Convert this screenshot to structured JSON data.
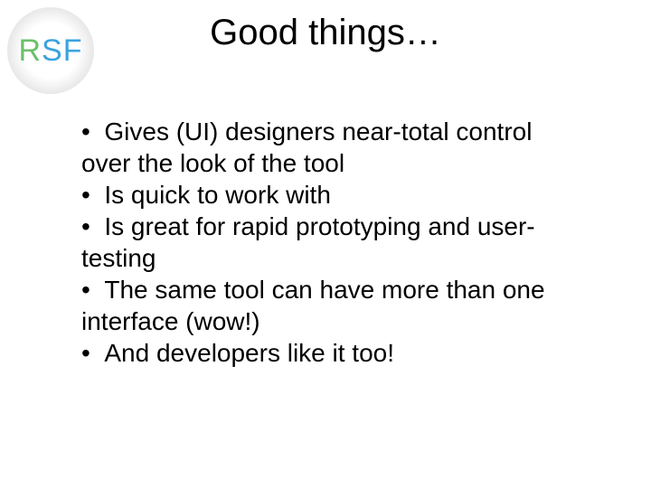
{
  "logo": {
    "letters": {
      "r": "R",
      "s": "S",
      "f": "F"
    }
  },
  "title": "Good things…",
  "bullets": [
    "Gives (UI) designers near-total control over the look of the tool",
    "Is quick to work with",
    "Is great for rapid prototyping and user-testing",
    "The same tool can have more than one interface (wow!)",
    "And developers like it too!"
  ]
}
